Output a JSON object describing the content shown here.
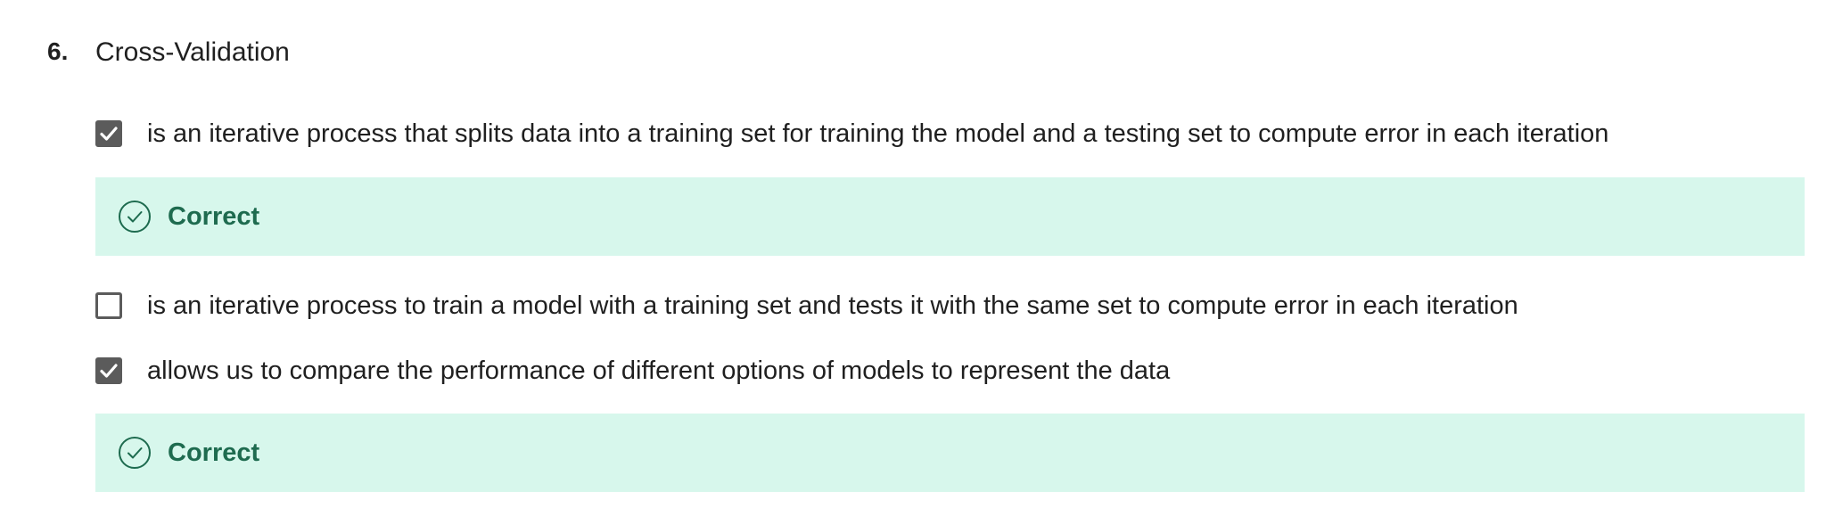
{
  "question": {
    "number": "6.",
    "title": "Cross-Validation"
  },
  "options": [
    {
      "label": "is an iterative process that splits data into a training set for training the model and a testing set to compute error in each iteration",
      "checked": true,
      "feedback": "Correct"
    },
    {
      "label": "is an iterative process to train a model with a training set and tests it with the same set to compute error in each iteration",
      "checked": false
    },
    {
      "label": "allows us to compare the performance of different options of models to represent the data",
      "checked": true,
      "feedback": "Correct"
    }
  ],
  "colors": {
    "checkbox": "#5b5b5b",
    "feedback_bg": "#d7f7ec",
    "feedback_text": "#1e6b4f"
  },
  "icons": {
    "checked": "checkmark-icon",
    "feedback": "check-circle-icon"
  }
}
